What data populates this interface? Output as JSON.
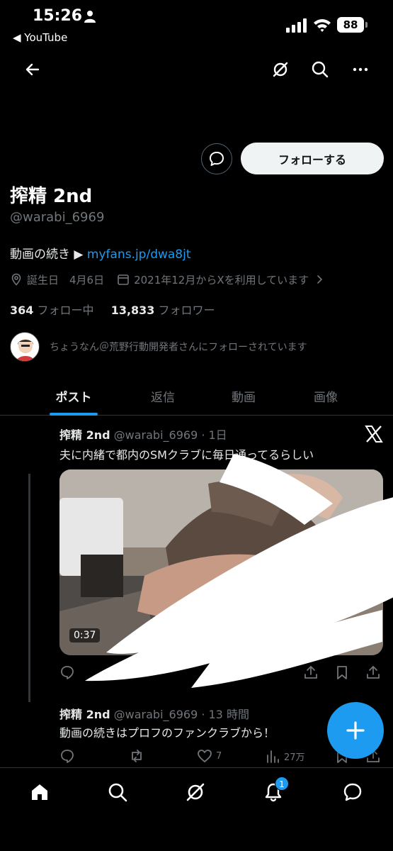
{
  "status_bar": {
    "time": "15:26",
    "back_app": "◀ YouTube",
    "battery": "88"
  },
  "profile": {
    "display_name": "搾精 2nd",
    "handle": "@warabi_6969",
    "bio_prefix": "動画の続き ▶ ",
    "bio_link": "myfans.jp/dwa8jt",
    "birthday_label": "誕生日　4月6日",
    "joined": "2021年12月からXを利用しています",
    "following_count": "364",
    "following_label": " フォロー中",
    "followers_count": "13,833",
    "followers_label": " フォロワー",
    "followed_by": "ちょうなん＠荒野行動開発者さんにフォローされています",
    "follow_button": "フォローする"
  },
  "tabs": [
    "ポスト",
    "返信",
    "動画",
    "画像"
  ],
  "posts": [
    {
      "name": "搾精 2nd",
      "meta": " @warabi_6969 · 1日",
      "text": "夫に内緒で都内のSMクラブに毎日通ってるらしい",
      "video_duration": "0:37"
    },
    {
      "name": "搾精 2nd",
      "meta": " @warabi_6969 · 13 時間",
      "text": "動画の続きはプロフのファンクラブから！",
      "likes": "7",
      "views": "27万"
    }
  ],
  "notifications_badge": "1",
  "colors": {
    "accent": "#1d9bf0",
    "background": "#000000",
    "secondary_text": "#71767b"
  }
}
